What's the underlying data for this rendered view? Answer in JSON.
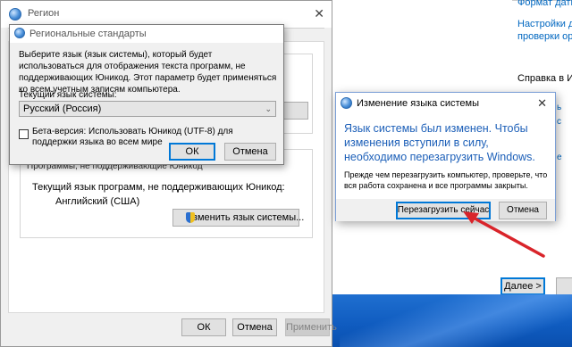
{
  "background_settings": {
    "links": [
      "Формат даты",
      "Настройки для",
      "проверки орфо"
    ],
    "help_text": "Справка в Инт",
    "next_button_label": "Далее >",
    "top_clipped_text": "..."
  },
  "region_window": {
    "title": "Регион",
    "group_label": "Программы, не поддерживающие Юникод",
    "current_language_label": "Текущий язык программ, не поддерживающих Юникод:",
    "current_language_value": "Английский (США)",
    "change_button_label": "Изменить язык системы...",
    "ok_label": "ОК",
    "cancel_label": "Отмена",
    "apply_label": "Применить"
  },
  "regional_standards_dialog": {
    "title": "Региональные стандарты",
    "description": "Выберите язык (язык системы), который будет использоваться для отображения текста программ, не поддерживающих Юникод. Этот параметр будет применяться ко всем учетным записям компьютера.",
    "current_system_language_label": "Текущий язык системы:",
    "selected_language": "Русский (Россия)",
    "beta_checkbox_label": "Бета-версия: Использовать Юникод (UTF-8) для поддержки языка во всем мире",
    "beta_checked": false,
    "ok_label": "ОК",
    "cancel_label": "Отмена"
  },
  "change_language_dialog": {
    "title": "Изменение языка системы",
    "main_message": "Язык системы был изменен. Чтобы изменения вступили в силу, необходимо перезагрузить Windows.",
    "secondary_message": "Прежде чем перезагрузить компьютер, проверьте, что вся работа сохранена и все программы закрыты.",
    "restart_button_label": "Перезагрузить сейчас",
    "cancel_button_label": "Отмена"
  },
  "colors": {
    "accent_blue": "#0078d7",
    "link_blue": "#0067c0",
    "main_message_blue": "#1c5fb8",
    "annotation_arrow": "#d9242a"
  }
}
